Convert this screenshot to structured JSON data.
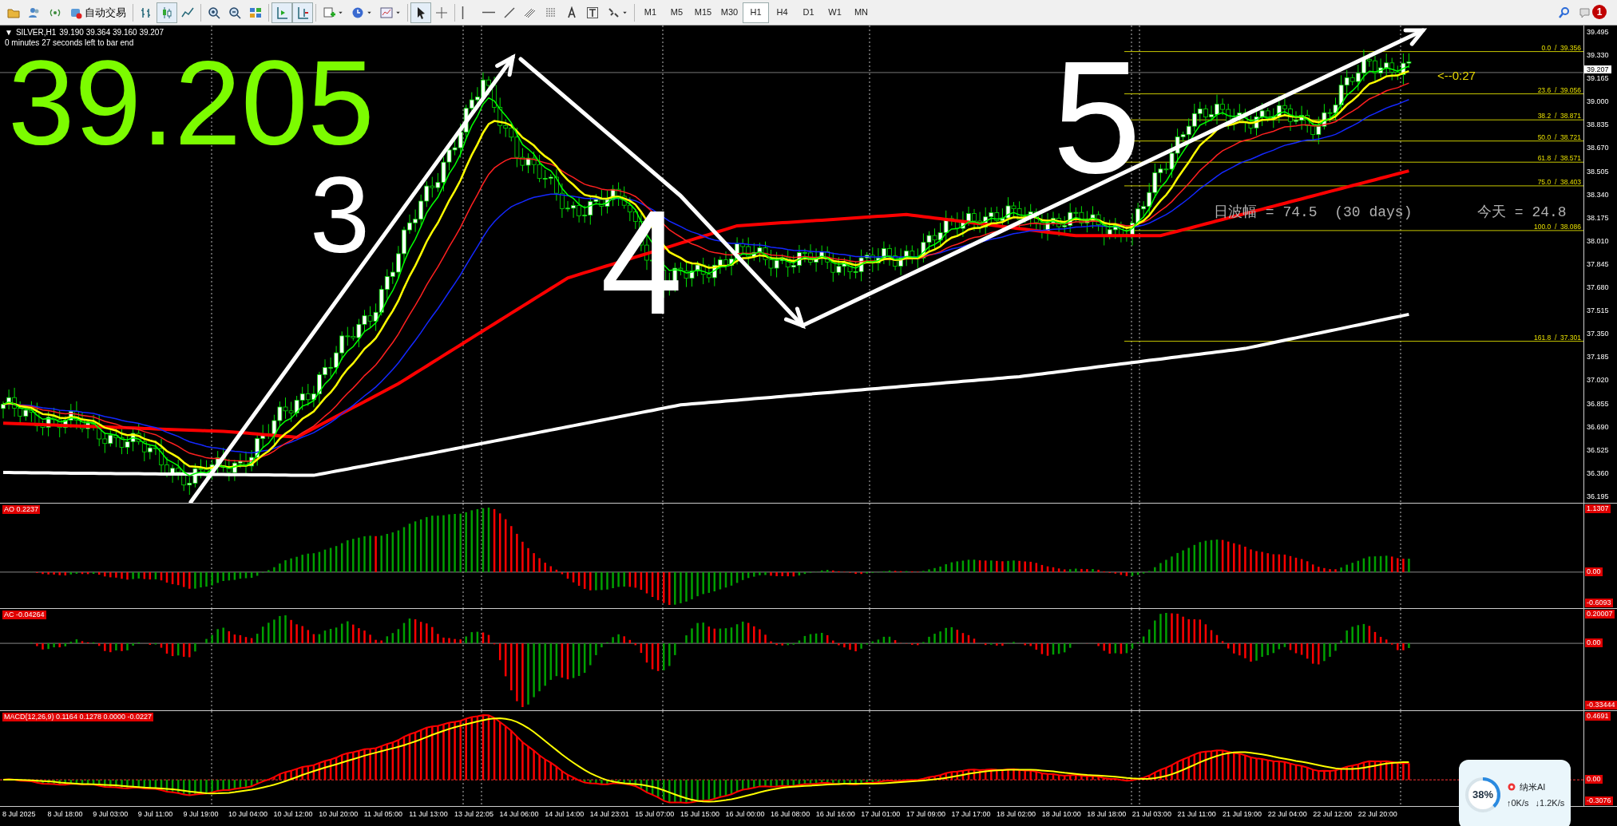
{
  "toolbar": {
    "tools": [
      {
        "kind": "folder",
        "pressed": false
      },
      {
        "kind": "profile",
        "pressed": false
      },
      {
        "kind": "signal",
        "pressed": false
      },
      {
        "kind": "autotrade",
        "pressed": false,
        "label": "自动交易"
      },
      {
        "kind": "bars",
        "pressed": false
      },
      {
        "kind": "candles",
        "pressed": true
      },
      {
        "kind": "line",
        "pressed": false
      },
      {
        "kind": "zoomin",
        "pressed": false
      },
      {
        "kind": "zoomout",
        "pressed": false
      },
      {
        "kind": "tile",
        "pressed": false
      },
      {
        "kind": "shift",
        "pressed": true
      },
      {
        "kind": "autoscroll",
        "pressed": true
      },
      {
        "kind": "indicator",
        "pressed": false
      },
      {
        "kind": "clock",
        "pressed": false
      },
      {
        "kind": "template",
        "pressed": false
      },
      {
        "kind": "cursor",
        "pressed": true
      },
      {
        "kind": "crosshair",
        "pressed": false
      },
      {
        "kind": "vline",
        "pressed": false
      },
      {
        "kind": "hline",
        "pressed": false
      },
      {
        "kind": "trend",
        "pressed": false
      },
      {
        "kind": "channel",
        "pressed": false
      },
      {
        "kind": "fibo",
        "pressed": false
      },
      {
        "kind": "text",
        "pressed": false
      },
      {
        "kind": "label",
        "pressed": false
      },
      {
        "kind": "arrows",
        "pressed": false
      }
    ],
    "timeframes": [
      {
        "label": "M1",
        "selected": false
      },
      {
        "label": "M5",
        "selected": false
      },
      {
        "label": "M15",
        "selected": false
      },
      {
        "label": "M30",
        "selected": false
      },
      {
        "label": "H1",
        "selected": true
      },
      {
        "label": "H4",
        "selected": false
      },
      {
        "label": "D1",
        "selected": false
      },
      {
        "label": "W1",
        "selected": false
      },
      {
        "label": "MN",
        "selected": false
      }
    ],
    "notification_badge": "1"
  },
  "chart": {
    "collapse_glyph": "▼",
    "symbol": "SILVER,H1",
    "ohlc": "39.190 39.364 39.160 39.207",
    "countdown": "0 minutes 27 seconds left to bar end",
    "big_price": "39.205",
    "wave_labels": [
      "3",
      "4",
      "5"
    ],
    "countdown_marker": "<--0:27",
    "range_text": "日波幅 = 74.5  (30 days)",
    "today_text": "今天 = 24.8",
    "fib_levels": [
      {
        "label": "0.0  /  39.356"
      },
      {
        "label": "23.6  /  39.056"
      },
      {
        "label": "38.2  /  38.871"
      },
      {
        "label": "50.0  /  38.721"
      },
      {
        "label": "61.8  /  38.571"
      },
      {
        "label": "75.0  /  38.403"
      },
      {
        "label": "100.0  /  38.086"
      },
      {
        "label": "161.8  /  37.301"
      }
    ],
    "price_axis": [
      "39.495",
      "39.330",
      "39.165",
      "39.000",
      "38.835",
      "38.670",
      "38.505",
      "38.340",
      "38.175",
      "38.010",
      "37.845",
      "37.680",
      "37.515",
      "37.350",
      "37.185",
      "37.020",
      "36.855",
      "36.690",
      "36.525",
      "36.360",
      "36.195"
    ],
    "current_price": "39.207"
  },
  "indicators": [
    {
      "kind": "ao",
      "label": "AO 0.2237",
      "axis": [
        "1.1307",
        "0.00",
        "-0.6093"
      ]
    },
    {
      "kind": "ac",
      "label": "AC -0.04264",
      "axis": [
        "0.20007",
        "0.00",
        "-0.33444"
      ]
    },
    {
      "kind": "macd",
      "label": "MACD(12,26,9) 0.1164 0.1278 0.0000 -0.0227",
      "axis": [
        "0.4691",
        "0.00",
        "-0.3076"
      ]
    }
  ],
  "time_axis": [
    "8 Jul 2025",
    "8 Jul 18:00",
    "9 Jul 03:00",
    "9 Jul 11:00",
    "9 Jul 19:00",
    "10 Jul 04:00",
    "10 Jul 12:00",
    "10 Jul 20:00",
    "11 Jul 05:00",
    "11 Jul 13:00",
    "13 Jul 22:05",
    "14 Jul 06:00",
    "14 Jul 14:00",
    "14 Jul 23:01",
    "15 Jul 07:00",
    "15 Jul 15:00",
    "16 Jul 00:00",
    "16 Jul 08:00",
    "16 Jul 16:00",
    "17 Jul 01:00",
    "17 Jul 09:00",
    "17 Jul 17:00",
    "18 Jul 02:00",
    "18 Jul 10:00",
    "18 Jul 18:00",
    "21 Jul 03:00",
    "21 Jul 11:00",
    "21 Jul 19:00",
    "22 Jul 04:00",
    "22 Jul 12:00",
    "22 Jul 20:00"
  ],
  "widget": {
    "percent": "38%",
    "level": 0.38,
    "title": "纳米AI",
    "upload": "↑0K/s",
    "download": "↓1.2K/s"
  }
}
